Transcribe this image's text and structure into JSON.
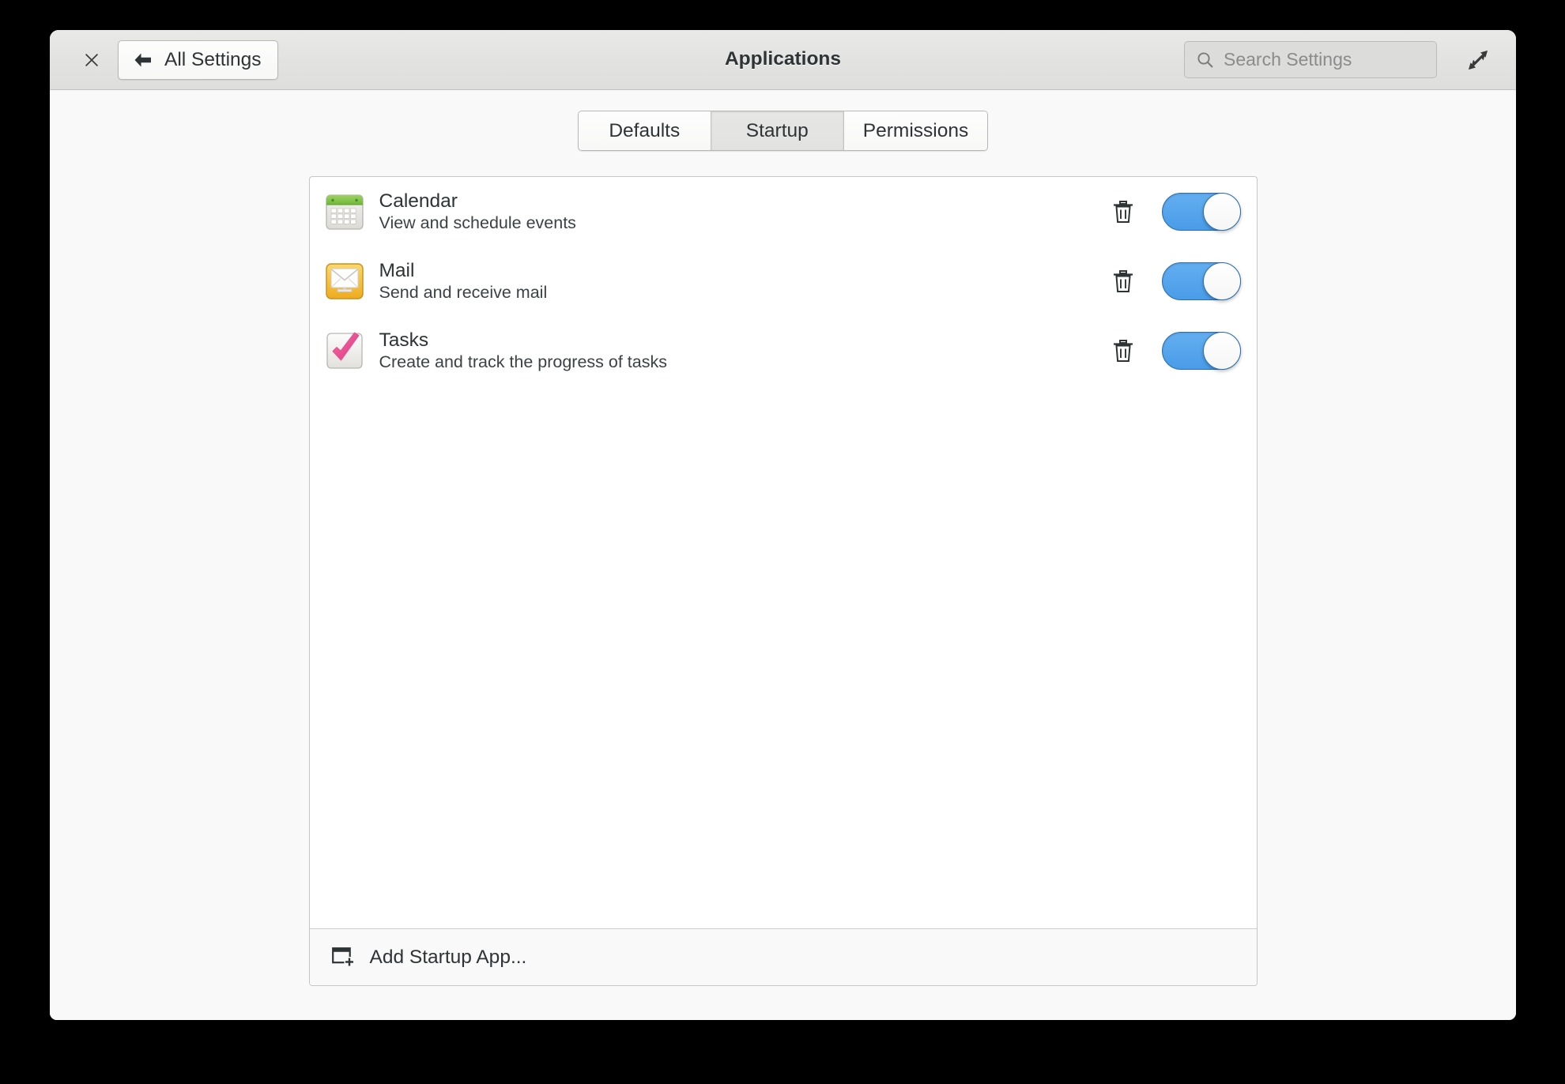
{
  "window": {
    "title": "Applications",
    "close_icon": "close-icon",
    "maximize_icon": "maximize-icon"
  },
  "header": {
    "back_button_label": "All Settings",
    "back_icon": "arrow-left-icon",
    "search": {
      "placeholder": "Search Settings",
      "value": "",
      "icon": "search-icon"
    }
  },
  "tabs": {
    "items": [
      {
        "label": "Defaults",
        "active": false
      },
      {
        "label": "Startup",
        "active": true
      },
      {
        "label": "Permissions",
        "active": false
      }
    ]
  },
  "startup_list": {
    "rows": [
      {
        "name": "Calendar",
        "description": "View and schedule events",
        "icon": "calendar-app-icon",
        "remove_icon": "trash-icon",
        "enabled": true
      },
      {
        "name": "Mail",
        "description": "Send and receive mail",
        "icon": "mail-app-icon",
        "remove_icon": "trash-icon",
        "enabled": true
      },
      {
        "name": "Tasks",
        "description": "Create and track the progress of tasks",
        "icon": "tasks-app-icon",
        "remove_icon": "trash-icon",
        "enabled": true
      }
    ],
    "footer": {
      "label": "Add Startup App...",
      "icon": "add-window-icon"
    }
  },
  "colors": {
    "toggle_on": "#4a9ce8",
    "calendar_green": "#7ac143",
    "mail_yellow": "#f5c342",
    "tasks_pink": "#ef5a9c",
    "desktop": "#000000",
    "window_bg": "#f9f9f9"
  }
}
